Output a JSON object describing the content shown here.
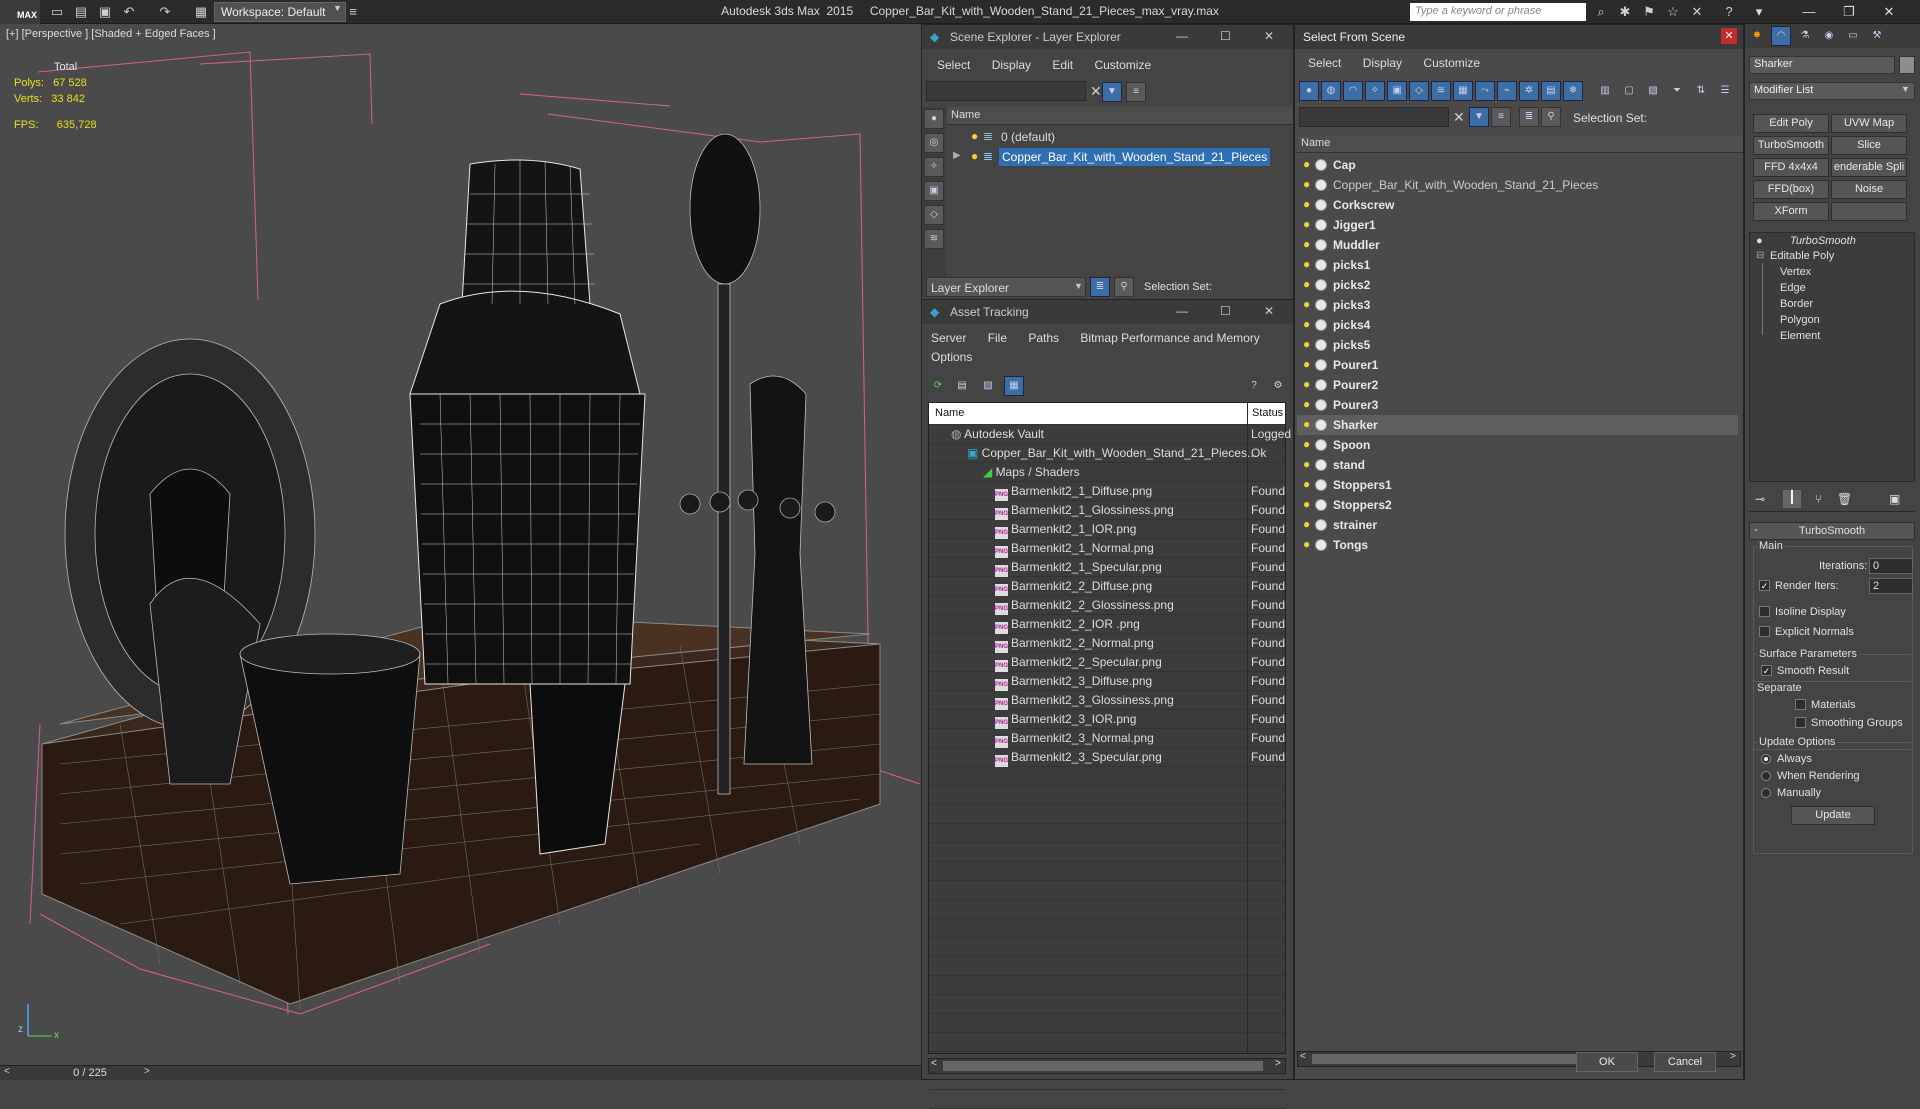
{
  "titlebar": {
    "logo": "MAX",
    "workspace": "Workspace: Default",
    "app_name": "Autodesk 3ds Max  2015",
    "file_name": "Copper_Bar_Kit_with_Wooden_Stand_21_Pieces_max_vray.max",
    "search_placeholder": "Type a keyword or phrase"
  },
  "viewport": {
    "label": "[+] [Perspective ] [Shaded + Edged Faces ]",
    "stats": {
      "total_label": "Total",
      "polys_label": "Polys:",
      "polys": "67 528",
      "verts_label": "Verts:",
      "verts": "33 842",
      "fps_label": "FPS:",
      "fps": "635,728"
    },
    "timeslider": "0 / 225",
    "axis_labels": [
      "x",
      "y",
      "z"
    ]
  },
  "scene_explorer": {
    "title": "Scene Explorer - Layer Explorer",
    "menu": [
      "Select",
      "Display",
      "Edit",
      "Customize"
    ],
    "column": "Name",
    "items": [
      {
        "name": "0 (default)",
        "selected": false
      },
      {
        "name": "Copper_Bar_Kit_with_Wooden_Stand_21_Pieces",
        "selected": true
      }
    ],
    "footer_dropdown": "Layer Explorer",
    "selection_set_label": "Selection Set:"
  },
  "asset_tracking": {
    "title": "Asset Tracking",
    "menu": [
      "Server",
      "File",
      "Paths",
      "Bitmap Performance and Memory",
      "Options"
    ],
    "columns": [
      "Name",
      "Status"
    ],
    "vault": {
      "name": "Autodesk Vault",
      "status": "Logged"
    },
    "file": {
      "name": "Copper_Bar_Kit_with_Wooden_Stand_21_Pieces...",
      "status": "Ok"
    },
    "maps_label": "Maps / Shaders",
    "png_tag": "PNG",
    "maps": [
      {
        "name": "Barmenkit2_1_Diffuse.png",
        "status": "Found"
      },
      {
        "name": "Barmenkit2_1_Glossiness.png",
        "status": "Found"
      },
      {
        "name": "Barmenkit2_1_IOR.png",
        "status": "Found"
      },
      {
        "name": "Barmenkit2_1_Normal.png",
        "status": "Found"
      },
      {
        "name": "Barmenkit2_1_Specular.png",
        "status": "Found"
      },
      {
        "name": "Barmenkit2_2_Diffuse.png",
        "status": "Found"
      },
      {
        "name": "Barmenkit2_2_Glossiness.png",
        "status": "Found"
      },
      {
        "name": "Barmenkit2_2_IOR .png",
        "status": "Found"
      },
      {
        "name": "Barmenkit2_2_Normal.png",
        "status": "Found"
      },
      {
        "name": "Barmenkit2_2_Specular.png",
        "status": "Found"
      },
      {
        "name": "Barmenkit2_3_Diffuse.png",
        "status": "Found"
      },
      {
        "name": "Barmenkit2_3_Glossiness.png",
        "status": "Found"
      },
      {
        "name": "Barmenkit2_3_IOR.png",
        "status": "Found"
      },
      {
        "name": "Barmenkit2_3_Normal.png",
        "status": "Found"
      },
      {
        "name": "Barmenkit2_3_Specular.png",
        "status": "Found"
      }
    ]
  },
  "select_from_scene": {
    "title": "Select From Scene",
    "menu": [
      "Select",
      "Display",
      "Customize"
    ],
    "selection_set_label": "Selection Set:",
    "column": "Name",
    "objects": [
      {
        "name": "Cap",
        "bold": true
      },
      {
        "name": "Copper_Bar_Kit_with_Wooden_Stand_21_Pieces",
        "bold": false
      },
      {
        "name": "Corkscrew",
        "bold": true
      },
      {
        "name": "Jigger1",
        "bold": true
      },
      {
        "name": "Muddler",
        "bold": true
      },
      {
        "name": "picks1",
        "bold": true
      },
      {
        "name": "picks2",
        "bold": true
      },
      {
        "name": "picks3",
        "bold": true
      },
      {
        "name": "picks4",
        "bold": true
      },
      {
        "name": "picks5",
        "bold": true
      },
      {
        "name": "Pourer1",
        "bold": true
      },
      {
        "name": "Pourer2",
        "bold": true
      },
      {
        "name": "Pourer3",
        "bold": true
      },
      {
        "name": "Sharker",
        "bold": true,
        "selected": true
      },
      {
        "name": "Spoon",
        "bold": true
      },
      {
        "name": "stand",
        "bold": true
      },
      {
        "name": "Stoppers1",
        "bold": true
      },
      {
        "name": "Stoppers2",
        "bold": true
      },
      {
        "name": "strainer",
        "bold": true
      },
      {
        "name": "Tongs",
        "bold": true
      }
    ],
    "ok_label": "OK",
    "cancel_label": "Cancel"
  },
  "command_panel": {
    "object_name": "Sharker",
    "modifier_list": "Modifier List",
    "buttons": [
      "Edit Poly",
      "UVW Map",
      "TurboSmooth",
      "Slice",
      "FFD 4x4x4",
      "enderable Spli",
      "FFD(box)",
      "Noise",
      "XForm",
      ""
    ],
    "stack": {
      "turbosmooth": "TurboSmooth",
      "editable_poly": "Editable Poly",
      "subobjects": [
        "Vertex",
        "Edge",
        "Border",
        "Polygon",
        "Element"
      ]
    },
    "rollout": {
      "title": "TurboSmooth",
      "main_label": "Main",
      "iterations_label": "Iterations:",
      "iterations": "0",
      "render_iters_label": "Render Iters:",
      "render_iters": "2",
      "render_iters_checked": true,
      "isoline_label": "Isoline Display",
      "explicit_label": "Explicit Normals",
      "surface_label": "Surface Parameters",
      "smooth_result_label": "Smooth Result",
      "smooth_result_checked": true,
      "separate_label": "Separate",
      "materials_label": "Materials",
      "smoothing_groups_label": "Smoothing Groups",
      "update_options_label": "Update Options",
      "always_label": "Always",
      "when_rendering_label": "When Rendering",
      "manually_label": "Manually",
      "update_label": "Update"
    }
  }
}
